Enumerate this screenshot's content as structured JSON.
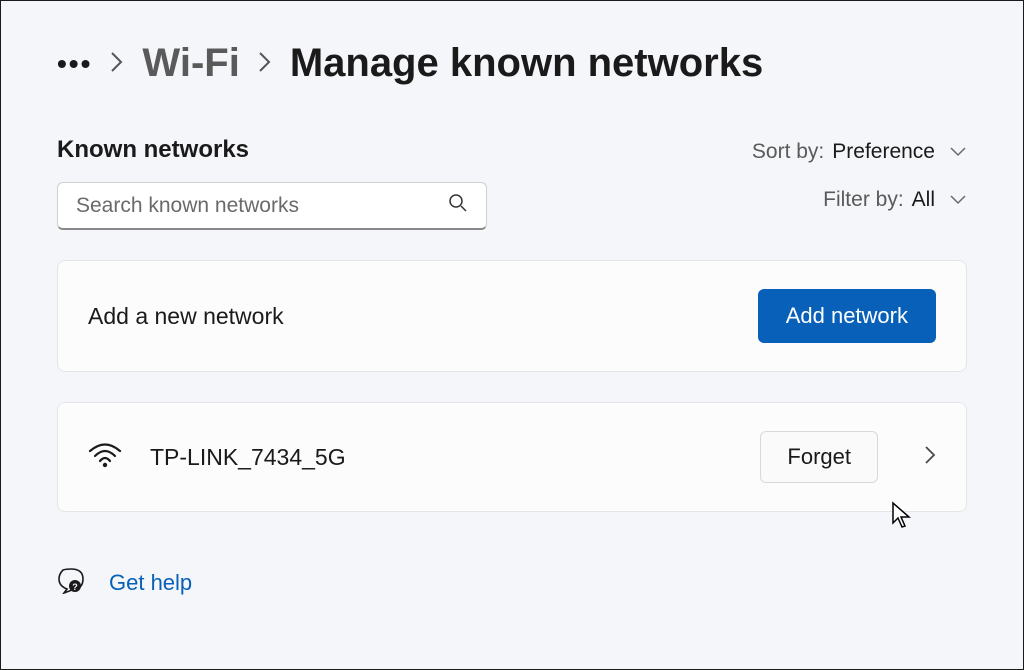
{
  "breadcrumb": {
    "ellipsis": "•••",
    "parent": "Wi-Fi",
    "current": "Manage known networks"
  },
  "section_title": "Known networks",
  "search": {
    "placeholder": "Search known networks"
  },
  "sort": {
    "label": "Sort by:",
    "value": "Preference"
  },
  "filter": {
    "label": "Filter by:",
    "value": "All"
  },
  "add_network": {
    "text": "Add a new network",
    "button": "Add network"
  },
  "networks": [
    {
      "name": "TP-LINK_7434_5G",
      "forget": "Forget"
    }
  ],
  "help": {
    "label": "Get help"
  }
}
